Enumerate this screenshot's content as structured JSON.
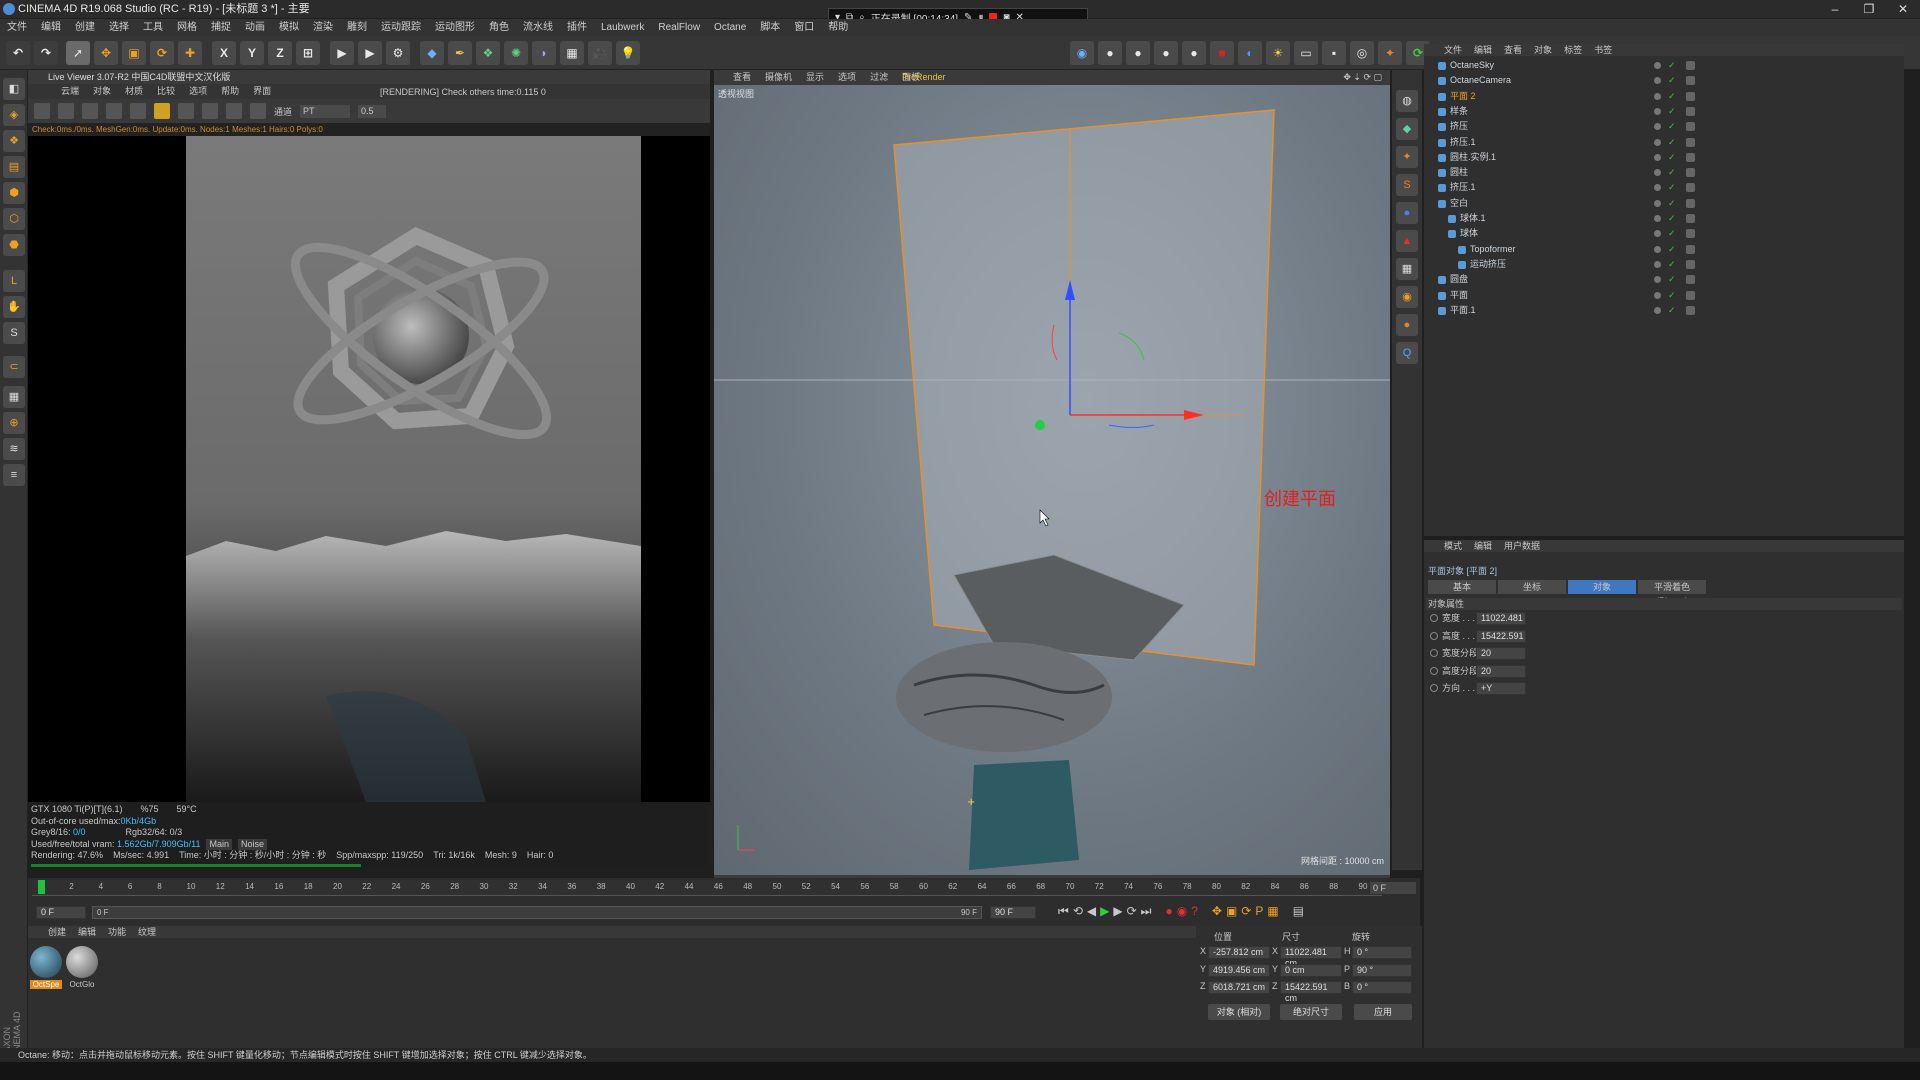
{
  "window": {
    "title": "CINEMA 4D R19.068 Studio (RC - R19) - [未标题 3 *] - 主要",
    "controls": [
      "–",
      "❐",
      "✕"
    ]
  },
  "recording": {
    "label": "正在录制 [00:14:34]"
  },
  "menubar": [
    "文件",
    "编辑",
    "创建",
    "选择",
    "工具",
    "网格",
    "捕捉",
    "动画",
    "模拟",
    "渲染",
    "雕刻",
    "运动跟踪",
    "运动图形",
    "角色",
    "流水线",
    "插件",
    "Laubwerk",
    "RealFlow",
    "Octane",
    "脚本",
    "窗口",
    "帮助"
  ],
  "toolbar": {
    "axes": [
      "X",
      "Y",
      "Z"
    ]
  },
  "live_viewer": {
    "title": "Live Viewer 3.07-R2 中国C4D联盟中文汉化版",
    "menu": [
      "云端",
      "对象",
      "材质",
      "比较",
      "选项",
      "帮助",
      "界面"
    ],
    "rendering_msg": "[RENDERING] Check others time:0.115  0",
    "channel_label": "通道",
    "channel_value": "PT",
    "zoom_value": "0.5",
    "status_line": "Check:0ms./0ms. MeshGen:0ms. Update:0ms. Nodes:1 Meshes:1 Hairs:0 Polys:0",
    "info": {
      "gpu": "GTX 1080 Ti(P)[T](6.1)",
      "gpu_load": "%75",
      "gpu_temp": "59°C",
      "outofcore": "Out-of-core used/max:",
      "outofcore_val": "0Kb/4Gb",
      "grey": "Grey8/16: ",
      "grey_val": "0/0",
      "rgb": "Rgb32/64: 0/3",
      "vram": "Used/free/total vram: ",
      "vram_val": "1.562Gb/7.909Gb/11",
      "tab_main": "Main",
      "tab_noise": "Noise",
      "rendering": "Rendering: 47.6%",
      "mssec": "Ms/sec: 4.991",
      "time": "Time: 小时 : 分钟 : 秒/小时 : 分钟 : 秒",
      "spp": "Spp/maxspp: 119/250",
      "tri": "Tri: 1k/16k",
      "mesh": "Mesh: 9",
      "hair": "Hair: 0"
    }
  },
  "viewport": {
    "menu": [
      "查看",
      "摄像机",
      "显示",
      "选项",
      "过滤",
      "面板"
    ],
    "prorender": "ProRender",
    "view_label": "透视视图",
    "annotation": "创建平面",
    "grid_label": "网格间距 : 10000 cm"
  },
  "object_manager": {
    "menu": [
      "文件",
      "编辑",
      "查看",
      "对象",
      "标签",
      "书签"
    ],
    "rows": [
      {
        "name": "OctaneSky",
        "indent": 0
      },
      {
        "name": "OctaneCamera",
        "indent": 0
      },
      {
        "name": "平面 2",
        "indent": 0,
        "selected": true
      },
      {
        "name": "样条",
        "indent": 0
      },
      {
        "name": "挤压",
        "indent": 0
      },
      {
        "name": "挤压.1",
        "indent": 0
      },
      {
        "name": "圆柱.实例.1",
        "indent": 0
      },
      {
        "name": "圆柱",
        "indent": 0
      },
      {
        "name": "挤压.1",
        "indent": 0
      },
      {
        "name": "空白",
        "indent": 0
      },
      {
        "name": "球体.1",
        "indent": 1
      },
      {
        "name": "球体",
        "indent": 1
      },
      {
        "name": "Topoformer",
        "indent": 2
      },
      {
        "name": "运动挤压",
        "indent": 2
      },
      {
        "name": "圆盘",
        "indent": 0
      },
      {
        "name": "平面",
        "indent": 0
      },
      {
        "name": "平面.1",
        "indent": 0
      }
    ]
  },
  "attributes": {
    "menu": [
      "模式",
      "编辑",
      "用户数据"
    ],
    "title": "平面对象 [平面 2]",
    "tabs": [
      "基本",
      "坐标",
      "对象",
      "平滑着色(Phong)"
    ],
    "active_tab": "对象",
    "section": "对象属性",
    "fields": [
      {
        "label": "宽度 . . . . . .",
        "value": "11022.481"
      },
      {
        "label": "高度 . . . . . .",
        "value": "15422.591"
      },
      {
        "label": "宽度分段",
        "value": "20"
      },
      {
        "label": "高度分段",
        "value": "20"
      },
      {
        "label": "方向 . . . . . .",
        "value": "+Y"
      }
    ]
  },
  "timeline": {
    "ticks": [
      "0",
      "2",
      "4",
      "6",
      "8",
      "10",
      "12",
      "14",
      "16",
      "18",
      "20",
      "22",
      "24",
      "26",
      "28",
      "30",
      "32",
      "34",
      "36",
      "38",
      "40",
      "42",
      "44",
      "46",
      "48",
      "50",
      "52",
      "54",
      "56",
      "58",
      "60",
      "62",
      "64",
      "66",
      "68",
      "70",
      "72",
      "74",
      "76",
      "78",
      "80",
      "82",
      "84",
      "86",
      "88",
      "90"
    ],
    "current_end": "0 F",
    "start_frame": "0 F",
    "min_frame": "0 F",
    "max_frame": "90 F",
    "end_frame": "90 F"
  },
  "materials": {
    "menu": [
      "创建",
      "编辑",
      "功能",
      "纹理"
    ],
    "items": [
      {
        "name": "OctSpe"
      },
      {
        "name": "OctGlo"
      }
    ]
  },
  "coordinates": {
    "headers": [
      "位置",
      "尺寸",
      "旋转"
    ],
    "rows": [
      {
        "axis": "X",
        "pos": "-257.812 cm",
        "saxis": "X",
        "size": "11022.481 cm",
        "raxis": "H",
        "rot": "0 °"
      },
      {
        "axis": "Y",
        "pos": "4919.456 cm",
        "saxis": "Y",
        "size": "0 cm",
        "raxis": "P",
        "rot": "90 °"
      },
      {
        "axis": "Z",
        "pos": "6018.721 cm",
        "saxis": "Z",
        "size": "15422.591 cm",
        "raxis": "B",
        "rot": "0 °"
      }
    ],
    "mode": "对象 (相对)",
    "size_mode": "绝对尺寸",
    "apply": "应用"
  },
  "status": "Octane: 移动：点击并拖动鼠标移动元素。按住 SHIFT 键量化移动；节点编辑模式时按住 SHIFT 键增加选择对象；按住 CTRL 键减少选择对象。",
  "side_logo": "MAXON CINEMA 4D"
}
